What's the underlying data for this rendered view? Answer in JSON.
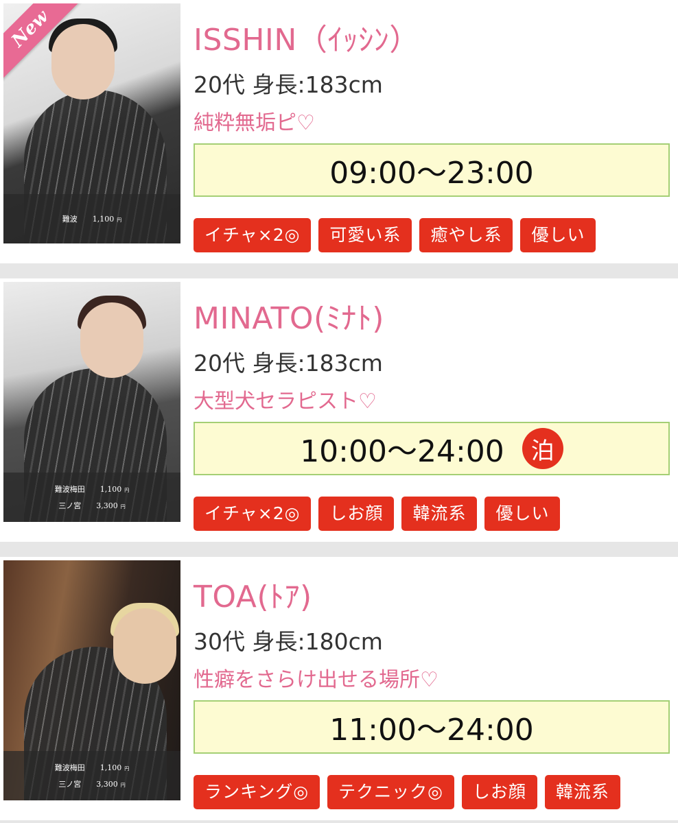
{
  "colors": {
    "name_pink": "#e2698f",
    "tag_red": "#e4301e",
    "schedule_bg": "#fdfbd2",
    "schedule_border": "#a4cf74",
    "new_badge": "#e86a94"
  },
  "cards": [
    {
      "badge": "New",
      "name": "ISSHIN（ｲｯｼﾝ）",
      "age_height": "20代 身長:183cm",
      "catchphrase": "純粋無垢ピ♡",
      "schedule": "09:00〜23:00",
      "prices": [
        {
          "area": "難波",
          "price": "1,100",
          "unit": "円"
        }
      ],
      "tags": [
        "イチャ×2◎",
        "可愛い系",
        "癒やし系",
        "優しい"
      ]
    },
    {
      "name": "MINATO(ﾐﾅﾄ)",
      "age_height": "20代 身長:183cm",
      "catchphrase": "大型犬セラピスト♡",
      "schedule": "10:00〜24:00",
      "stay_icon": "泊",
      "prices": [
        {
          "area": "難波梅田",
          "price": "1,100",
          "unit": "円"
        },
        {
          "area": "三ノ宮",
          "price": "3,300",
          "unit": "円"
        }
      ],
      "tags": [
        "イチャ×2◎",
        "しお顔",
        "韓流系",
        "優しい"
      ]
    },
    {
      "name": "TOA(ﾄｱ)",
      "age_height": "30代 身長:180cm",
      "catchphrase": "性癖をさらけ出せる場所♡",
      "schedule": "11:00〜24:00",
      "prices": [
        {
          "area": "難波梅田",
          "price": "1,100",
          "unit": "円"
        },
        {
          "area": "三ノ宮",
          "price": "3,300",
          "unit": "円"
        }
      ],
      "tags": [
        "ランキング◎",
        "テクニック◎",
        "しお顔",
        "韓流系"
      ]
    }
  ]
}
